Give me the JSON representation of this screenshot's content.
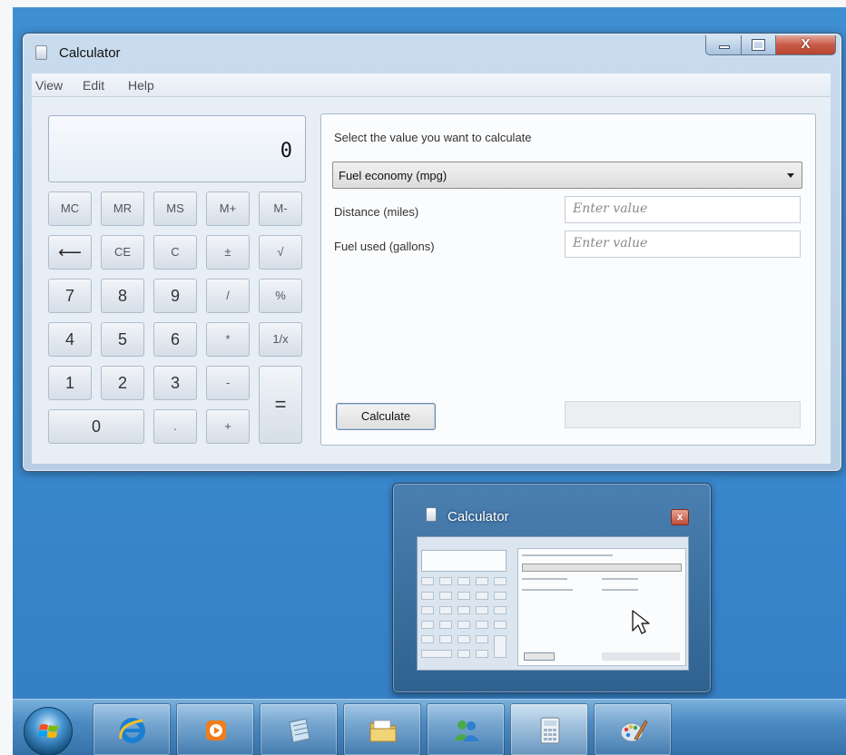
{
  "window": {
    "title": "Calculator",
    "controls": {
      "minimize": "–",
      "maximize": "□",
      "close": "X"
    }
  },
  "menu": [
    "View",
    "Edit",
    "Help"
  ],
  "display": {
    "value": "0"
  },
  "keypad": {
    "memory": [
      "MC",
      "MR",
      "MS",
      "M+",
      "M-"
    ],
    "row2": [
      "⟵",
      "CE",
      "C",
      "±",
      "√"
    ],
    "row3": [
      "7",
      "8",
      "9",
      "/",
      "%"
    ],
    "row4": [
      "4",
      "5",
      "6",
      "*",
      "1/x"
    ],
    "row5": [
      "1",
      "2",
      "3",
      "-"
    ],
    "row6": [
      "0",
      ".",
      "+"
    ],
    "equals": "="
  },
  "panel": {
    "heading": "Select the value you want to calculate",
    "mode": "Fuel economy (mpg)",
    "fields": [
      {
        "label": "Distance (miles)",
        "placeholder": "Enter value"
      },
      {
        "label": "Fuel used (gallons)",
        "placeholder": "Enter value"
      }
    ],
    "calculate_label": "Calculate",
    "result": ""
  },
  "thumbnail": {
    "title": "Calculator",
    "close": "x"
  },
  "taskbar": {
    "start": "start-orb",
    "apps": [
      "internet-explorer-icon",
      "media-player-icon",
      "notepad-icon",
      "file-explorer-icon",
      "people-icon",
      "calculator-icon",
      "paint-icon"
    ],
    "active_app": "calculator-icon"
  },
  "colors": {
    "desktop": "#3a8ad0",
    "window_frame": "#b7cde3",
    "close_button": "#c85a45"
  }
}
